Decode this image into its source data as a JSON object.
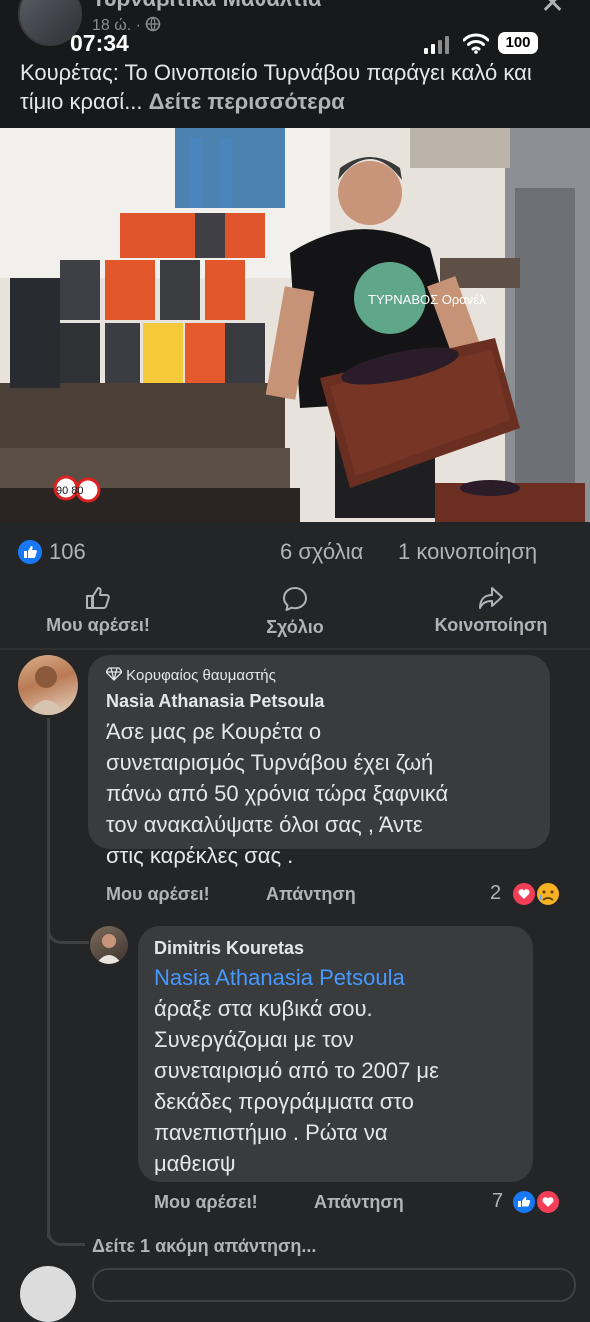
{
  "header": {
    "page_name": "Τυρναβιτικα Μαθαλτια",
    "time_ago": "18 ώ. ·",
    "close": "✕"
  },
  "status_bar": {
    "time": "07:34",
    "battery": "100"
  },
  "post": {
    "caption": "Κουρέτας: Το Οινοποιείο Τυρνάβου παράγει καλό και τίμιο κρασί...",
    "see_more": "Δείτε περισσότερα",
    "photo_label": "ΤΥΡΝΑΒΟΣ Ορανέλ",
    "plate": "90 80"
  },
  "stats": {
    "reactions": "106",
    "comments": "6 σχόλια",
    "shares": "1 κοινοποίηση"
  },
  "actions": {
    "like": "Μου αρέσει!",
    "comment": "Σχόλιο",
    "share": "Κοινοποίηση"
  },
  "comments": [
    {
      "badge": "Κορυφαίος θαυμαστής",
      "author": "Nasia Athanasia Petsoula",
      "lines": [
        "Άσε μας ρε Κουρέτα ο",
        "συνεταιρισμός Τυρνάβου έχει ζωή",
        "πάνω από 50 χρόνια τώρα ξαφνικά",
        "τον ανακαλύψατε όλοι σας , Άντε",
        "στις καρέκλες σας ."
      ],
      "like": "Μου αρέσει!",
      "reply": "Απάντηση",
      "reaction_count": "2"
    },
    {
      "author": "Dimitris Kouretas",
      "mention": "Nasia Athanasia Petsoula",
      "lines": [
        "άραξε στα κυβικά σου.",
        "Συνεργάζομαι με τον",
        "συνεταιρισμό από το 2007 με",
        "δεκάδες προγράμματα στο",
        "πανεπιστήμιο . Ρώτα να",
        "μαθεισψ"
      ],
      "like": "Μου αρέσει!",
      "reply": "Απάντηση",
      "reaction_count": "7"
    }
  ],
  "more_replies": "Δείτε 1 ακόμη απάντηση...",
  "colors": {
    "background": "#242526",
    "bubble": "#3a3b3c",
    "accent": "#1877f2",
    "mention": "#4599ff",
    "love": "#f33e58"
  }
}
